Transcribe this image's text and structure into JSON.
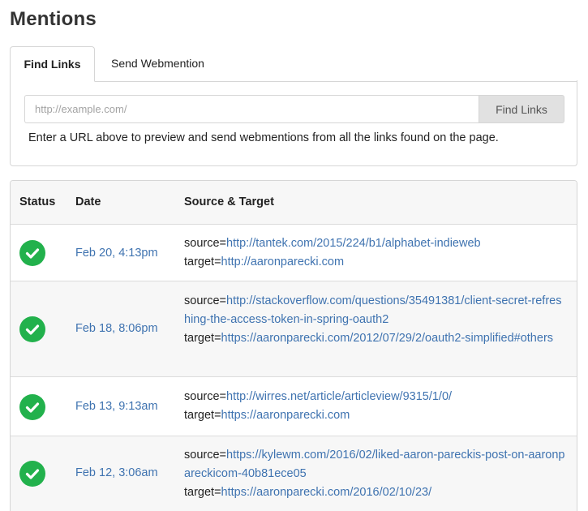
{
  "page": {
    "title": "Mentions"
  },
  "tabs": [
    {
      "label": "Find Links",
      "active": true
    },
    {
      "label": "Send Webmention",
      "active": false
    }
  ],
  "find_links": {
    "url_placeholder": "http://example.com/",
    "url_value": "",
    "button_label": "Find Links",
    "hint": "Enter a URL above to preview and send webmentions from all the links found on the page."
  },
  "table": {
    "columns": [
      "Status",
      "Date",
      "Source & Target"
    ],
    "source_prefix": "source=",
    "target_prefix": "target=",
    "rows": [
      {
        "status": "success",
        "date": "Feb 20, 4:13pm",
        "source": "http://tantek.com/2015/224/b1/alphabet-indieweb",
        "target": "http://aaronparecki.com"
      },
      {
        "status": "success",
        "date": "Feb 18, 8:06pm",
        "source": "http://stackoverflow.com/questions/35491381/client-secret-refreshing-the-access-token-in-spring-oauth2",
        "target": "https://aaronparecki.com/2012/07/29/2/oauth2-simplified#others"
      },
      {
        "status": "success",
        "date": "Feb 13, 9:13am",
        "source": "http://wirres.net/article/articleview/9315/1/0/",
        "target": "https://aaronparecki.com"
      },
      {
        "status": "success",
        "date": "Feb 12, 3:06am",
        "source": "https://kylewm.com/2016/02/liked-aaron-pareckis-post-on-aaronpareckicom-40b81ece05",
        "target": "https://aaronparecki.com/2016/02/10/23/"
      }
    ]
  },
  "colors": {
    "link": "#3f73b0",
    "success": "#22b14c",
    "header_bg": "#f7f7f7",
    "button_bg": "#e1e1e1"
  }
}
